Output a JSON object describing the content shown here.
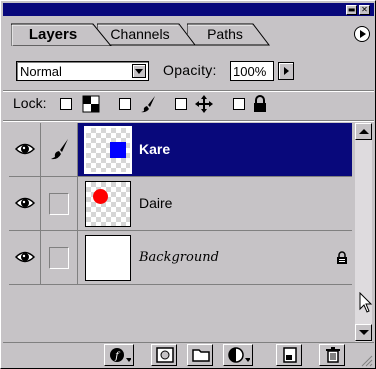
{
  "panel": {
    "tabs": [
      {
        "label": "Layers",
        "active": true
      },
      {
        "label": "Channels",
        "active": false
      },
      {
        "label": "Paths",
        "active": false
      }
    ],
    "window_buttons": {
      "minimize": "▬",
      "close": "✕"
    }
  },
  "blend": {
    "mode": "Normal",
    "opacity_label": "Opacity:",
    "opacity_value": "100%"
  },
  "lock": {
    "label": "Lock:",
    "options": [
      "lock-transparency-icon",
      "lock-brush-icon",
      "lock-move-icon",
      "lock-all-icon"
    ]
  },
  "layers": [
    {
      "name": "Kare",
      "selected": true,
      "visible": true,
      "linked_brush": true,
      "thumb": "blue-square"
    },
    {
      "name": "Daire",
      "selected": false,
      "visible": true,
      "linked_brush": false,
      "thumb": "red-circle"
    },
    {
      "name": "Background",
      "selected": false,
      "visible": true,
      "linked_brush": false,
      "thumb": "white",
      "locked": true
    }
  ],
  "colors": {
    "title_bar": "#08087b",
    "selected_row": "#08087b",
    "panel_bg": "#c6c3c6",
    "square": "#0000ff",
    "circle": "#ff0000"
  },
  "toolbar_icons": [
    "layer-style-icon",
    "add-mask-icon",
    "new-set-icon",
    "adjustment-layer-icon",
    "new-layer-icon",
    "trash-icon"
  ]
}
